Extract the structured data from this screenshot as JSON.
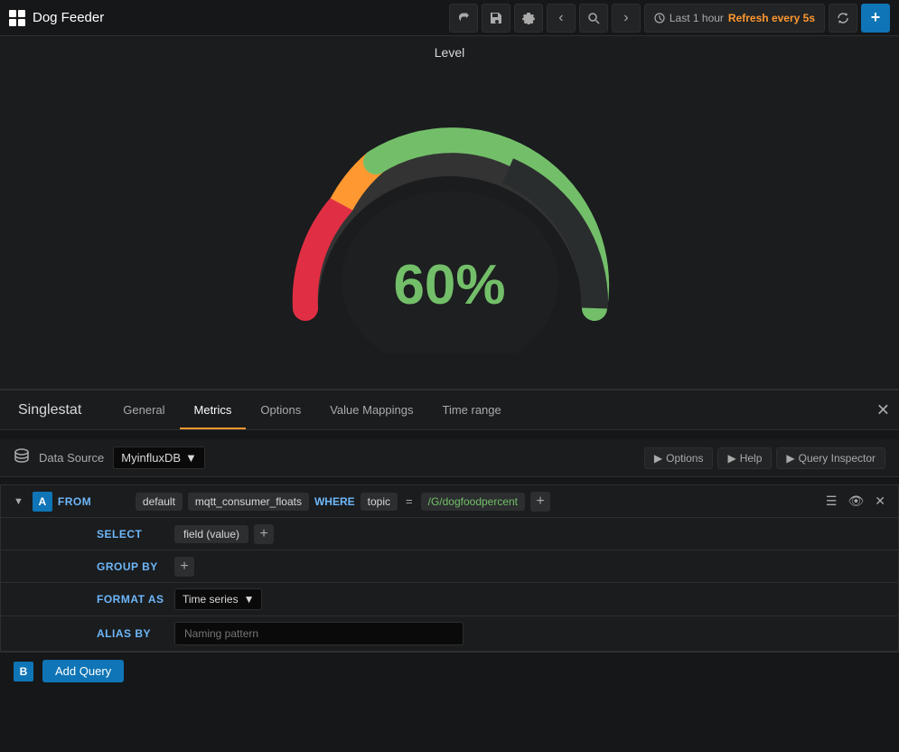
{
  "topbar": {
    "logo_label": "Dog Feeder",
    "share_icon": "↗",
    "save_icon": "💾",
    "settings_icon": "⚙",
    "back_icon": "‹",
    "zoom_icon": "⊕",
    "forward_icon": "›",
    "time_range": "Last 1 hour",
    "refresh_rate": "Refresh every 5s",
    "sync_icon": "⟳",
    "add_icon": "+"
  },
  "gauge": {
    "title": "Level",
    "value": "60%",
    "percentage": 60
  },
  "edit_panel": {
    "title": "Singlestat",
    "tabs": [
      "General",
      "Metrics",
      "Options",
      "Value Mappings",
      "Time range"
    ],
    "active_tab": "Metrics"
  },
  "datasource": {
    "label": "Data Source",
    "name": "MyinfluxDB",
    "options_btn": "Options",
    "help_btn": "Help",
    "query_inspector_btn": "Query Inspector"
  },
  "query": {
    "id": "A",
    "from_label": "FROM",
    "default_pill": "default",
    "measurement": "mqtt_consumer_floats",
    "where_label": "WHERE",
    "where_key": "topic",
    "where_equals": "=",
    "where_value": "/G/dogfoodpercent",
    "select_label": "SELECT",
    "field_value": "field (value)",
    "group_by_label": "GROUP BY",
    "format_as_label": "FORMAT AS",
    "format_value": "Time series",
    "alias_label": "ALIAS BY",
    "alias_placeholder": "Naming pattern"
  },
  "add_query": {
    "b_label": "B",
    "btn_label": "Add Query"
  }
}
